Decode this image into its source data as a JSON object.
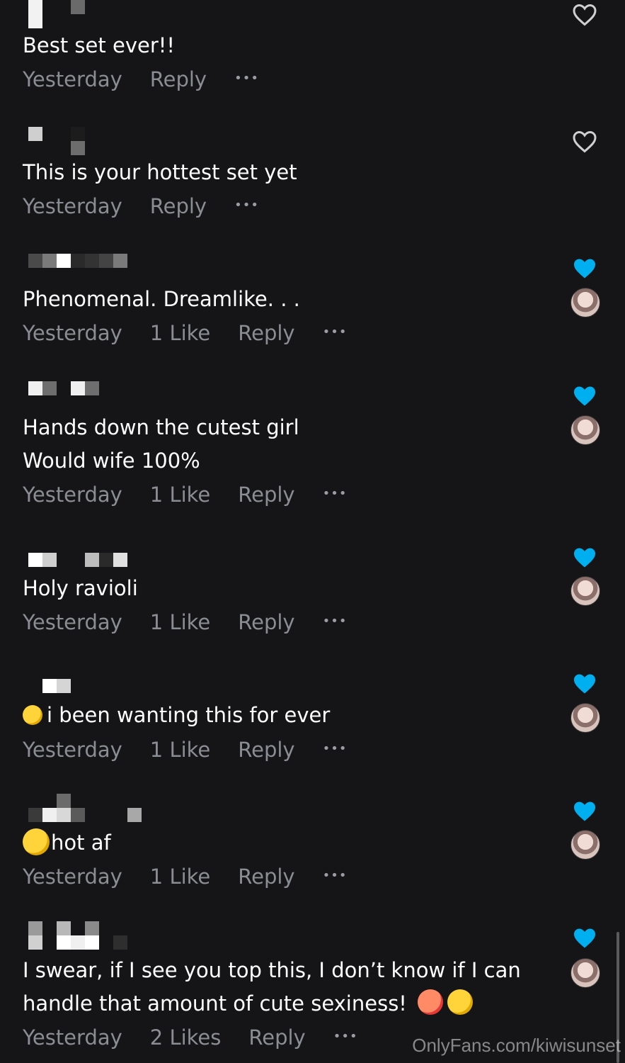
{
  "comments": [
    {
      "lines": [
        "Best set ever!!"
      ],
      "time": "Yesterday",
      "likes": "",
      "reply": "Reply",
      "more": "•••",
      "liked": false,
      "creator_avatar": false
    },
    {
      "lines": [
        "This is your hottest set yet"
      ],
      "time": "Yesterday",
      "likes": "",
      "reply": "Reply",
      "more": "•••",
      "liked": false,
      "creator_avatar": false
    },
    {
      "lines": [
        "Phenomenal. Dreamlike. . ."
      ],
      "time": "Yesterday",
      "likes": "1 Like",
      "reply": "Reply",
      "more": "•••",
      "liked": true,
      "creator_avatar": true
    },
    {
      "lines": [
        "Hands down the cutest girl",
        "Would wife 100%"
      ],
      "time": "Yesterday",
      "likes": "1 Like",
      "reply": "Reply",
      "more": "•••",
      "liked": true,
      "creator_avatar": true
    },
    {
      "lines": [
        "Holy ravioli"
      ],
      "time": "Yesterday",
      "likes": "1 Like",
      "reply": "Reply",
      "more": "•••",
      "liked": true,
      "creator_avatar": true
    },
    {
      "lines": [
        "i been wanting this for ever"
      ],
      "emoji_prefix": "drooling-face-emoji",
      "time": "Yesterday",
      "likes": "1 Like",
      "reply": "Reply",
      "more": "•••",
      "liked": true,
      "creator_avatar": true
    },
    {
      "lines": [
        "hot af"
      ],
      "emoji_prefix": "kissing-face-emoji",
      "time": "Yesterday",
      "likes": "1 Like",
      "reply": "Reply",
      "more": "•••",
      "liked": true,
      "creator_avatar": true
    },
    {
      "lines": [
        "I swear, if I see you top this, I don’t know if I can",
        "handle that amount of cute sexiness!"
      ],
      "emoji_suffix": [
        "hot-face-emoji",
        "drooling-face-emoji"
      ],
      "time": "Yesterday",
      "likes": "2 Likes",
      "reply": "Reply",
      "more": "•••",
      "liked": true,
      "creator_avatar": true
    }
  ],
  "watermark": "OnlyFans.com/kiwisunset",
  "colors": {
    "background": "#151517",
    "text": "#ffffff",
    "meta": "#8a8d93",
    "heart_liked": "#00aff0",
    "heart_outline": "#d0d0d0"
  },
  "icons": {
    "like": "heart-icon",
    "more": "more-dots-icon"
  }
}
